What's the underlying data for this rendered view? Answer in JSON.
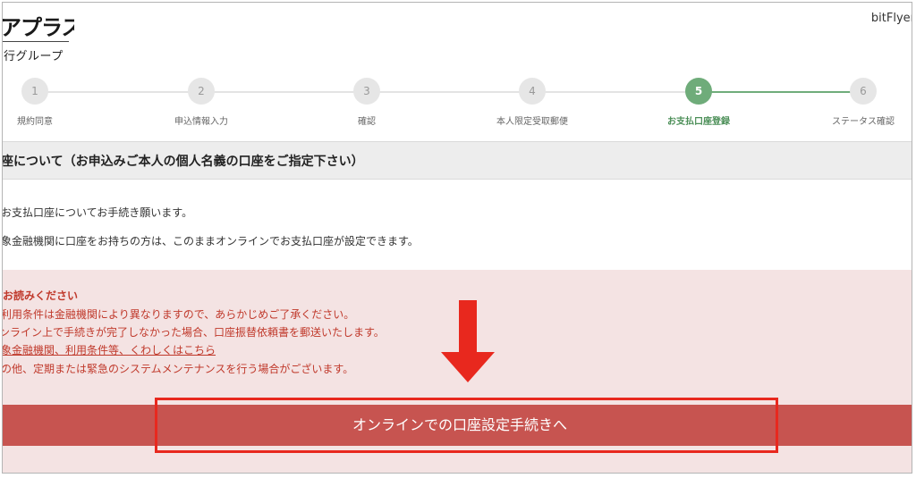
{
  "header": {
    "brand_name": "アプラス",
    "brand_sub": "行グループ",
    "user_name": "bitFlyer"
  },
  "stepper": {
    "steps": [
      {
        "number": "1",
        "label": "規約同意",
        "state": "done"
      },
      {
        "number": "2",
        "label": "申込情報入力",
        "state": "done"
      },
      {
        "number": "3",
        "label": "確認",
        "state": "done"
      },
      {
        "number": "4",
        "label": "本人限定受取郵便",
        "state": "done"
      },
      {
        "number": "5",
        "label": "お支払口座登録",
        "state": "current"
      },
      {
        "number": "6",
        "label": "ステータス確認",
        "state": "todo"
      }
    ],
    "active_color": "#6fac7a"
  },
  "section": {
    "title": "座について（お申込みご本人の個人名義の口座をご指定下さい）",
    "line1": "お支払口座についてお手続き願います。",
    "line2": "象金融機関に口座をお持ちの方は、このままオンラインでお支払口座が設定できます。"
  },
  "notice": {
    "title": "お読みください",
    "lines": [
      "利用条件は金融機関により異なりますので、あらかじめご了承ください。",
      "ンライン上で手続きが完了しなかった場合、口座振替依頼書を郵送いたします。",
      "象金融機関、利用条件等、くわしくはこちら",
      "の他、定期または緊急のシステムメンテナンスを行う場合がございます。"
    ],
    "text_color": "#c0392b",
    "background": "#f4e3e3"
  },
  "cta": {
    "label": "オンラインでの口座設定手続きへ",
    "color": "#c75450"
  },
  "annotation": {
    "arrow_icon": "down-arrow-icon",
    "highlight_color": "#e8281e"
  }
}
